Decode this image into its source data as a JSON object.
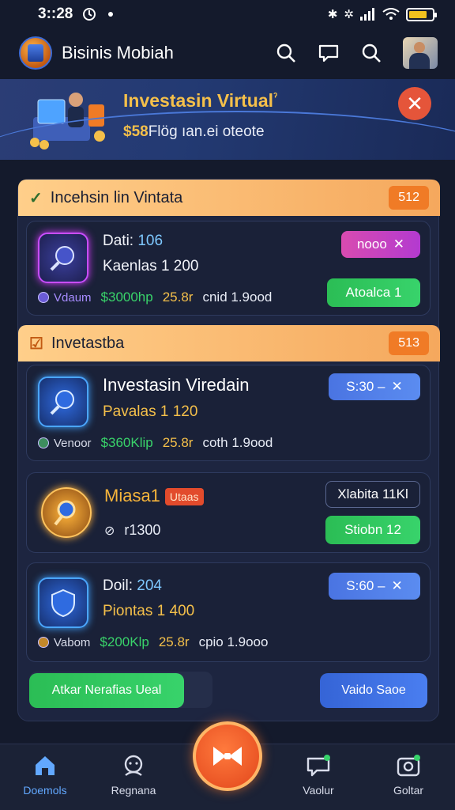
{
  "status_bar": {
    "time": "3::28"
  },
  "header": {
    "app_title": "Bisinis Mobiah",
    "icons": [
      "search-icon",
      "notification-icon",
      "search-icon",
      "profile-avatar"
    ]
  },
  "banner": {
    "title": "Investasin Virtual",
    "title_suffix": "ˀ",
    "amount": "$58",
    "subtitle": "Flög ıan.ei oteote"
  },
  "section1": {
    "title": "Incehsin lin Vintata",
    "badge": "512",
    "card": {
      "line1_label": "Dati: ",
      "line1_value": "106",
      "line2": "Kaenlas 1 200",
      "meta_label": "Vdaum",
      "meta_green": "$3000hp",
      "meta_yellow": "25.8r",
      "meta_white": "cnid 1.9ood",
      "pill_top": "nooo",
      "pill_bottom": "Atoalca 1"
    }
  },
  "section2": {
    "title": "Invetastba",
    "badge": "513",
    "cards": [
      {
        "title": "Investasin Viredain",
        "line2": "Pavalas 1 120",
        "meta_label": "Venoor",
        "meta_green": "$360Klip",
        "meta_yellow": "25.8r",
        "meta_white": "coth 1.9ood",
        "pill_top": "S:30 –"
      },
      {
        "title": "Miasa1",
        "tag": "Utaas",
        "line2": "r1300",
        "pill_top": "Xlabita 11Kl",
        "pill_bottom": "Stiobn 12"
      },
      {
        "line1_label": "Doil: ",
        "line1_value": "204",
        "line2": "Piontas 1 400",
        "meta_label": "Vabom",
        "meta_green": "$200Klp",
        "meta_yellow": "25.8r",
        "meta_white": "cpio 1.9ooo",
        "pill_top": "S:60 –"
      }
    ]
  },
  "footer": {
    "left_button": "Atkar Nerafias Ueal",
    "right_button": "Vaido Saoe"
  },
  "bottom_nav": [
    {
      "label": "Doemols",
      "icon": "home-icon"
    },
    {
      "label": "Regnana",
      "icon": "support-icon"
    },
    {
      "label": "Vaolur",
      "icon": "chat-icon"
    },
    {
      "label": "Goltar",
      "icon": "camera-icon"
    }
  ],
  "colors": {
    "background": "#141a2c",
    "accent_gold": "#f5c04a",
    "accent_green": "#38d36b",
    "accent_orange": "#f07b26",
    "active_nav": "#62a8ff"
  }
}
